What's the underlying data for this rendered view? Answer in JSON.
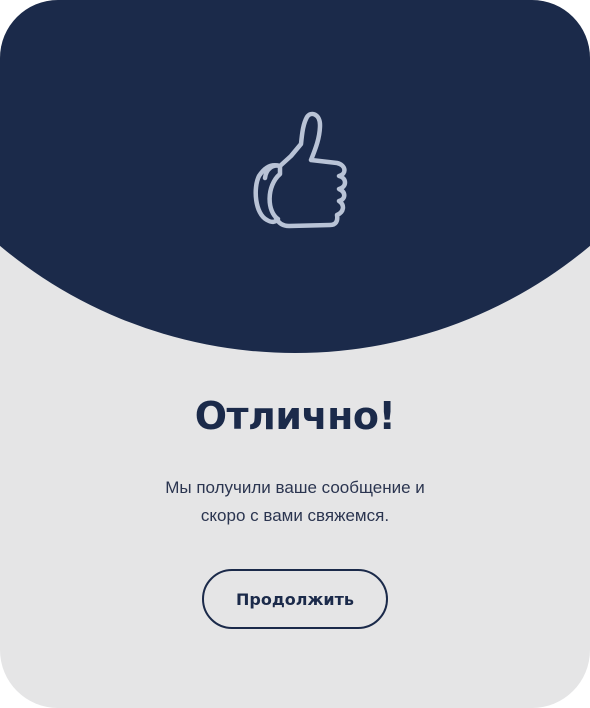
{
  "dialog": {
    "icon": "thumbs-up-icon",
    "title": "Отлично!",
    "message_lines": [
      "Мы получили ваше сообщение и",
      "скоро с вами свяжемся."
    ],
    "continue_label": "Продолжить"
  },
  "colors": {
    "header": "#1b2a4a",
    "card_background": "#e5e5e6",
    "icon_stroke": "#b9c3d6",
    "text": "#1b2a4a"
  }
}
